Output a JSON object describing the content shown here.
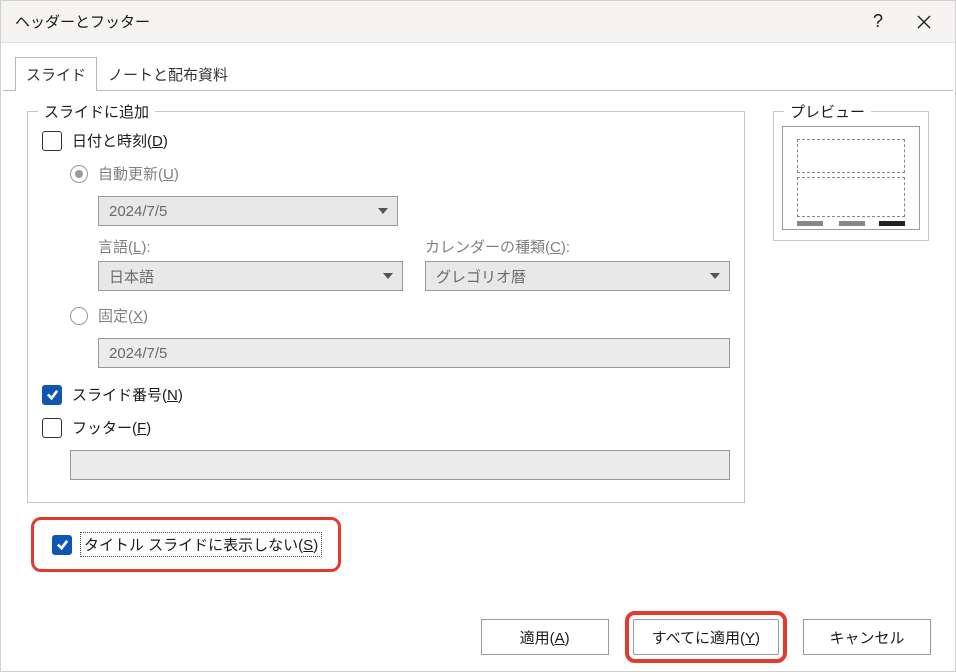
{
  "title": "ヘッダーとフッター",
  "tabs": {
    "slide": "スライド",
    "notes": "ノートと配布資料"
  },
  "group": {
    "addToSlide": "スライドに追加",
    "preview": "プレビュー"
  },
  "labels": {
    "dateTime": "日付と時刻(",
    "dateTimeKey": "D",
    "autoUpdate": "自動更新(",
    "autoUpdateKey": "U",
    "dateValue": "2024/7/5",
    "language": "言語(",
    "languageKey": "L",
    "languageClose": "):",
    "languageValue": "日本語",
    "calendar": "カレンダーの種類(",
    "calendarKey": "C",
    "calendarClose": "):",
    "calendarValue": "グレゴリオ暦",
    "fixed": "固定(",
    "fixedKey": "X",
    "fixedValue": "2024/7/5",
    "slideNumber": "スライド番号(",
    "slideNumberKey": "N",
    "footer": "フッター(",
    "footerKey": "F",
    "dontShowOnTitle": "タイトル スライドに表示しない(",
    "dontShowOnTitleKey": "S",
    "closeParen": ")"
  },
  "buttons": {
    "apply": "適用(",
    "applyKey": "A",
    "applyAll": "すべてに適用(",
    "applyAllKey": "Y",
    "cancel": "キャンセル"
  }
}
